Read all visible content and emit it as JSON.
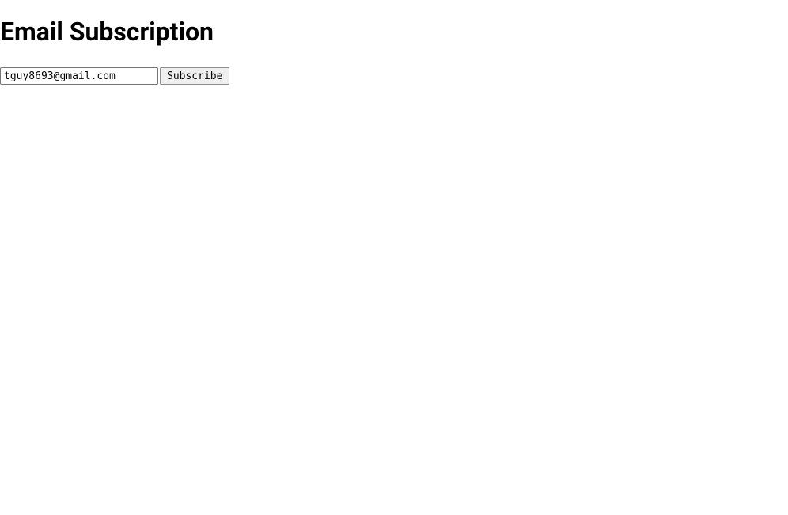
{
  "page": {
    "title": "Email Subscription"
  },
  "form": {
    "email_value": "tguy8693@gmail.com",
    "subscribe_label": "Subscribe"
  }
}
